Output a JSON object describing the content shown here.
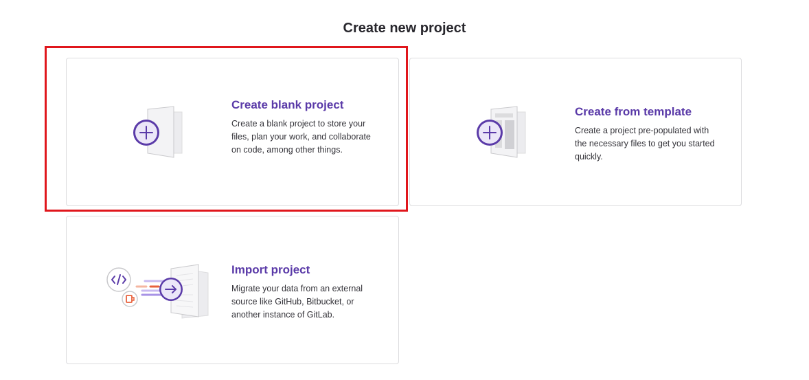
{
  "page": {
    "title": "Create new project"
  },
  "cards": {
    "blank": {
      "title": "Create blank project",
      "description": "Create a blank project to store your files, plan your work, and collaborate on code, among other things.",
      "icon": "blank-project-illustration"
    },
    "template": {
      "title": "Create from template",
      "description": "Create a project pre-populated with the necessary files to get you started quickly.",
      "icon": "template-project-illustration"
    },
    "import": {
      "title": "Import project",
      "description": "Migrate your data from an external source like GitHub, Bitbucket, or another instance of GitLab.",
      "icon": "import-project-illustration"
    }
  },
  "colors": {
    "accent": "#5a3aa8",
    "highlight": "#e0161c",
    "border": "#dcdcde"
  }
}
